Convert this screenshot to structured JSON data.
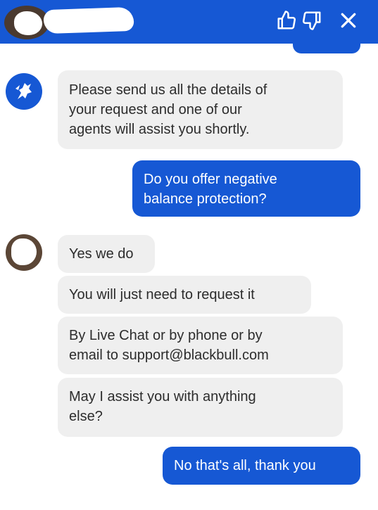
{
  "header": {
    "icons": [
      "thumbs-up-icon",
      "thumbs-down-icon",
      "close-icon"
    ],
    "background": "#1658d4"
  },
  "messages": [
    {
      "sender": "bot",
      "text": "Please send us all the details of\nyour request and one of our\nagents will assist you shortly."
    },
    {
      "sender": "user",
      "text": "Do you offer negative\nbalance protection?"
    },
    {
      "sender": "agent",
      "text": "Yes we do"
    },
    {
      "sender": "agent",
      "text": "You will just need to request it"
    },
    {
      "sender": "agent",
      "text": "By Live Chat or by phone or by\nemail to support@blackbull.com"
    },
    {
      "sender": "agent",
      "text": "May I assist you with anything\nelse?"
    },
    {
      "sender": "user",
      "text": "No that's all, thank you"
    }
  ],
  "colors": {
    "accent": "#1658d4",
    "incoming_bubble": "#efefef",
    "incoming_text": "#2c2c2c"
  }
}
